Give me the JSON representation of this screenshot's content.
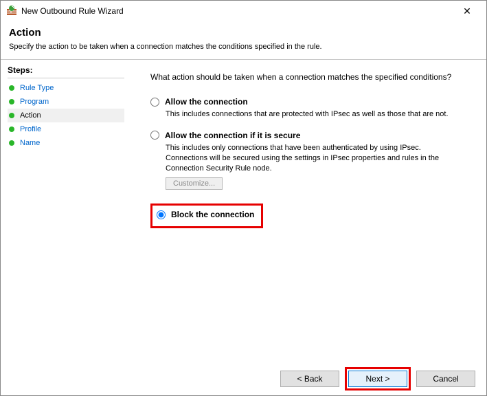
{
  "window": {
    "title": "New Outbound Rule Wizard"
  },
  "header": {
    "title": "Action",
    "description": "Specify the action to be taken when a connection matches the conditions specified in the rule."
  },
  "sidebar": {
    "title": "Steps:",
    "items": [
      {
        "label": "Rule Type",
        "state": "done"
      },
      {
        "label": "Program",
        "state": "done"
      },
      {
        "label": "Action",
        "state": "current"
      },
      {
        "label": "Profile",
        "state": "pending"
      },
      {
        "label": "Name",
        "state": "pending"
      }
    ]
  },
  "main": {
    "question": "What action should be taken when a connection matches the specified conditions?",
    "options": {
      "allow": {
        "title": "Allow the connection",
        "desc": "This includes connections that are protected with IPsec as well as those that are not."
      },
      "allow_secure": {
        "title": "Allow the connection if it is secure",
        "desc": "This includes only connections that have been authenticated by using IPsec. Connections will be secured using the settings in IPsec properties and rules in the Connection Security Rule node.",
        "customize_label": "Customize..."
      },
      "block": {
        "title": "Block the connection"
      }
    },
    "selected": "block"
  },
  "footer": {
    "back": "< Back",
    "next": "Next >",
    "cancel": "Cancel"
  }
}
